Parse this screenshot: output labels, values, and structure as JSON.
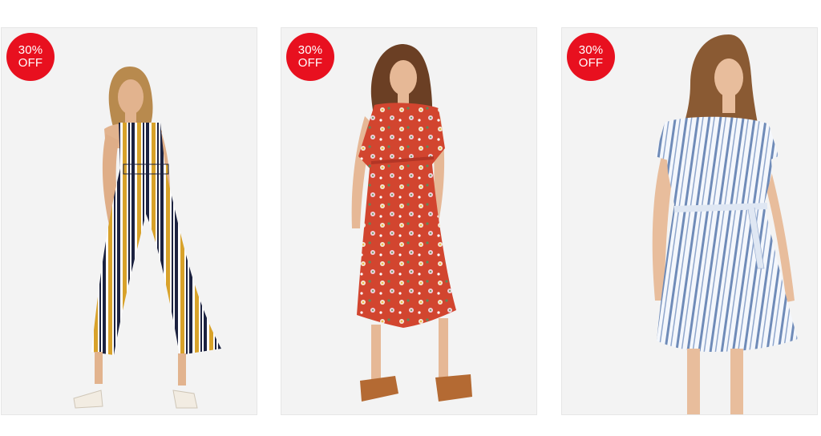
{
  "colors": {
    "badge": "#e8101f",
    "card_bg": "#f2f2f2"
  },
  "products": [
    {
      "badge": {
        "line1": "30%",
        "line2": "OFF"
      },
      "image_icon": "striped-jumpsuit-photo",
      "garment_color": "#ffffff"
    },
    {
      "badge": {
        "line1": "30%",
        "line2": "OFF"
      },
      "image_icon": "red-floral-wrap-dress-photo",
      "garment_color": "#d2452f"
    },
    {
      "badge": {
        "line1": "30%",
        "line2": "OFF"
      },
      "image_icon": "blue-striped-wrap-dress-photo",
      "garment_color": "#eef3fa"
    }
  ]
}
